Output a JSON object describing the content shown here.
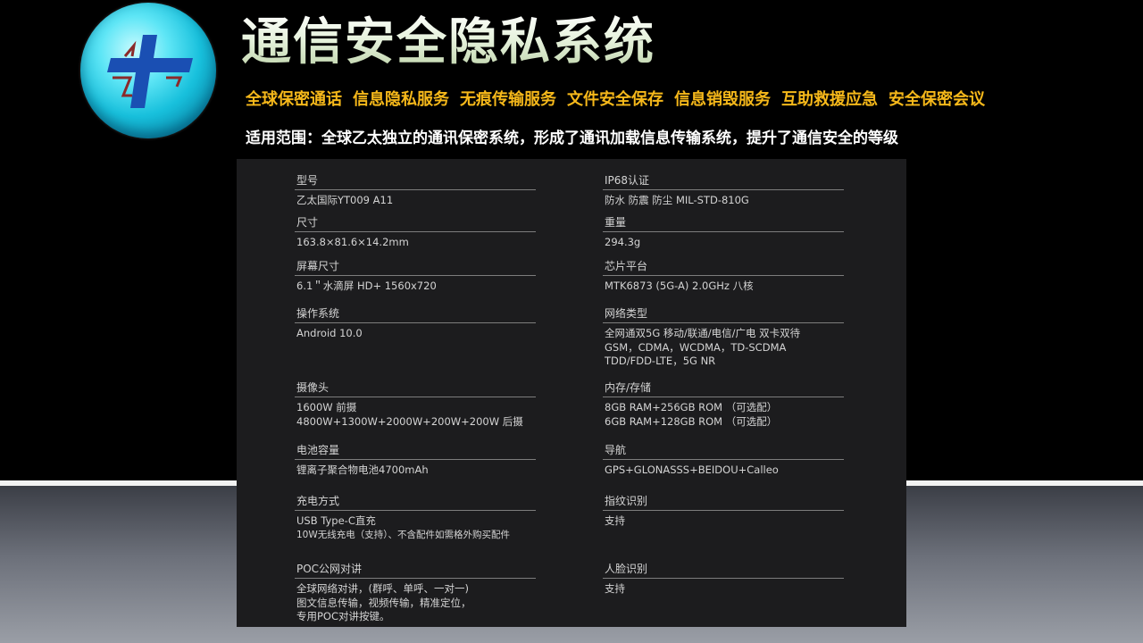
{
  "header": {
    "title": "通信安全隐私系统",
    "services": [
      "全球保密通话",
      "信息隐私服务",
      "无痕传输服务",
      "文件安全保存",
      "信息销毁服务",
      "互助救援应急",
      "安全保密会议"
    ],
    "scope": "适用范围：全球乙太独立的通讯保密系统，形成了通讯加载信息传输系统，提升了通信安全的等级"
  },
  "logo": {
    "icon": "cross-logo-icon",
    "colors": {
      "circle": "#18c0dc",
      "cross": "#1a4fb3",
      "outline": "#8b2a2a"
    }
  },
  "colors": {
    "services": "#f6b81a",
    "title": "#d9e8cc",
    "scope": "#ffffff",
    "spec_text": "#d4d4d4"
  },
  "specs": {
    "model": {
      "label": "型号",
      "lines": [
        "乙太国际YT009 A11"
      ]
    },
    "ip68": {
      "label": "IP68认证",
      "lines": [
        "防水 防震 防尘 MIL-STD-810G"
      ]
    },
    "size": {
      "label": "尺寸",
      "lines": [
        "163.8×81.6×14.2mm"
      ]
    },
    "weight": {
      "label": "重量",
      "lines": [
        "294.3g"
      ]
    },
    "screen": {
      "label": "屏幕尺寸",
      "lines": [
        "6.1＂水滴屏 HD+ 1560x720"
      ]
    },
    "chip": {
      "label": "芯片平台",
      "lines": [
        "MTK6873 (5G-A) 2.0GHz 八核"
      ]
    },
    "os": {
      "label": "操作系统",
      "lines": [
        "Android 10.0"
      ]
    },
    "network": {
      "label": "网络类型",
      "lines": [
        "全网通双5G 移动/联通/电信/广电 双卡双待",
        "GSM，CDMA，WCDMA，TD-SCDMA",
        "TDD/FDD-LTE，5G NR"
      ]
    },
    "camera": {
      "label": "摄像头",
      "lines": [
        "1600W 前摄",
        "4800W+1300W+2000W+200W+200W 后摄"
      ]
    },
    "memory": {
      "label": "内存/存储",
      "lines": [
        "8GB RAM+256GB ROM （可选配）",
        "6GB RAM+128GB ROM （可选配）"
      ]
    },
    "battery": {
      "label": "电池容量",
      "lines": [
        "锂离子聚合物电池4700mAh"
      ]
    },
    "navigation": {
      "label": "导航",
      "lines": [
        "GPS+GLONASSS+BEIDOU+Calleo"
      ]
    },
    "charging": {
      "label": "充电方式",
      "lines": [
        "USB Type-C直充",
        "10W无线充电（支持）、不含配件如需格外购买配件"
      ]
    },
    "fingerprint": {
      "label": "指纹识别",
      "lines": [
        "支持"
      ]
    },
    "poc": {
      "label": "POC公网对讲",
      "lines": [
        "全球网络对讲，(群呼、单呼、一对一)",
        "图文信息传输，视频传输，精准定位，",
        "专用POC对讲按键。"
      ]
    },
    "face": {
      "label": "人脸识别",
      "lines": [
        "支持"
      ]
    }
  }
}
